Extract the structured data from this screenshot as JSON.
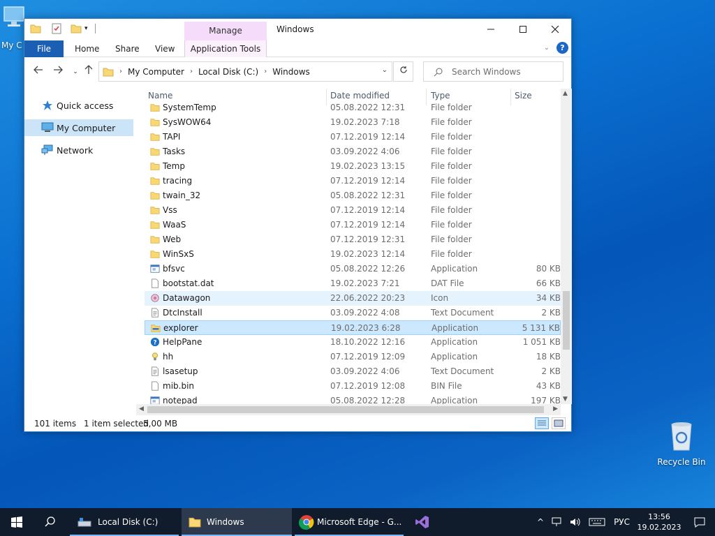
{
  "desktop": {
    "mycomputer_label": "My C",
    "recycle_label": "Recycle Bin"
  },
  "window": {
    "title": "Windows",
    "manage_tab": "Manage",
    "ribbon_tabs": {
      "file": "File",
      "home": "Home",
      "share": "Share",
      "view": "View",
      "apptools": "Application Tools"
    }
  },
  "address": {
    "crumbs": [
      "My Computer",
      "Local Disk (C:)",
      "Windows"
    ],
    "search_placeholder": "Search Windows"
  },
  "navpane": {
    "items": [
      {
        "label": "Quick access",
        "icon": "star-icon"
      },
      {
        "label": "My Computer",
        "icon": "computer-icon"
      },
      {
        "label": "Network",
        "icon": "network-icon"
      }
    ]
  },
  "columns": {
    "name": "Name",
    "date": "Date modified",
    "type": "Type",
    "size": "Size"
  },
  "files": [
    {
      "name": "SystemTemp",
      "date": "05.08.2022 12:31",
      "type": "File folder",
      "size": "",
      "icon": "folder"
    },
    {
      "name": "SysWOW64",
      "date": "19.02.2023 7:18",
      "type": "File folder",
      "size": "",
      "icon": "folder"
    },
    {
      "name": "TAPI",
      "date": "07.12.2019 12:14",
      "type": "File folder",
      "size": "",
      "icon": "folder"
    },
    {
      "name": "Tasks",
      "date": "03.09.2022 4:06",
      "type": "File folder",
      "size": "",
      "icon": "folder"
    },
    {
      "name": "Temp",
      "date": "19.02.2023 13:15",
      "type": "File folder",
      "size": "",
      "icon": "folder"
    },
    {
      "name": "tracing",
      "date": "07.12.2019 12:14",
      "type": "File folder",
      "size": "",
      "icon": "folder"
    },
    {
      "name": "twain_32",
      "date": "05.08.2022 12:31",
      "type": "File folder",
      "size": "",
      "icon": "folder"
    },
    {
      "name": "Vss",
      "date": "07.12.2019 12:14",
      "type": "File folder",
      "size": "",
      "icon": "folder"
    },
    {
      "name": "WaaS",
      "date": "07.12.2019 12:14",
      "type": "File folder",
      "size": "",
      "icon": "folder"
    },
    {
      "name": "Web",
      "date": "07.12.2019 12:31",
      "type": "File folder",
      "size": "",
      "icon": "folder"
    },
    {
      "name": "WinSxS",
      "date": "19.02.2023 12:14",
      "type": "File folder",
      "size": "",
      "icon": "folder"
    },
    {
      "name": "bfsvc",
      "date": "05.08.2022 12:26",
      "type": "Application",
      "size": "80 KB",
      "icon": "app"
    },
    {
      "name": "bootstat.dat",
      "date": "19.02.2023 7:21",
      "type": "DAT File",
      "size": "66 KB",
      "icon": "file"
    },
    {
      "name": "Datawagon",
      "date": "22.06.2022 20:23",
      "type": "Icon",
      "size": "34 KB",
      "icon": "iconfile",
      "state": "hover"
    },
    {
      "name": "DtcInstall",
      "date": "03.09.2022 4:08",
      "type": "Text Document",
      "size": "2 KB",
      "icon": "text"
    },
    {
      "name": "explorer",
      "date": "19.02.2023 6:28",
      "type": "Application",
      "size": "5 131 KB",
      "icon": "explorer",
      "state": "sel"
    },
    {
      "name": "HelpPane",
      "date": "18.10.2022 12:16",
      "type": "Application",
      "size": "1 051 KB",
      "icon": "help"
    },
    {
      "name": "hh",
      "date": "07.12.2019 12:09",
      "type": "Application",
      "size": "18 KB",
      "icon": "hh"
    },
    {
      "name": "lsasetup",
      "date": "03.09.2022 4:06",
      "type": "Text Document",
      "size": "2 KB",
      "icon": "text"
    },
    {
      "name": "mib.bin",
      "date": "07.12.2019 12:08",
      "type": "BIN File",
      "size": "43 KB",
      "icon": "file"
    },
    {
      "name": "notepad",
      "date": "05.08.2022 12:28",
      "type": "Application",
      "size": "197 KB",
      "icon": "app"
    }
  ],
  "status": {
    "count": "101 items",
    "selected": "1 item selected",
    "size": "5,00 MB"
  },
  "taskbar": {
    "items": [
      {
        "label": "Local Disk (C:)"
      },
      {
        "label": "Windows"
      },
      {
        "label": "Microsoft Edge - G..."
      }
    ],
    "lang": "РУС",
    "time": "13:56",
    "date": "19.02.2023"
  },
  "colors": {
    "accent": "#1a5fb4",
    "selection": "#cce8ff",
    "folder": "#f8d775"
  }
}
